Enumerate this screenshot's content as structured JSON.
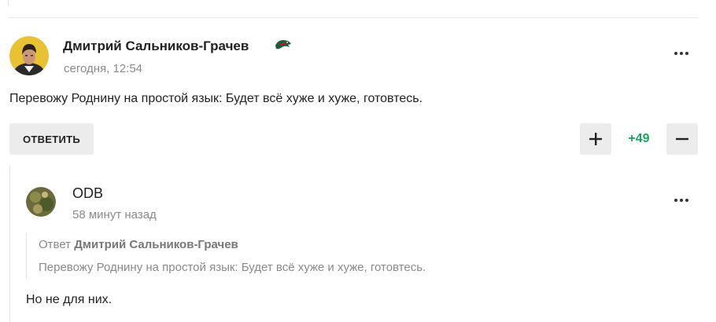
{
  "comments": [
    {
      "author": "Дмитрий Сальников-Грачев",
      "time": "сегодня, 12:54",
      "text": "Перевожу Роднину на простой язык: Будет всё хуже и хуже, готовтесь.",
      "reply_label": "ОТВЕТИТЬ",
      "score": "+49",
      "team_icon": "hockey-club-logo-icon"
    },
    {
      "author": "ODB",
      "time": "58 минут назад",
      "quote": {
        "prefix": "Ответ",
        "author": "Дмитрий Сальников-Грачев",
        "text": "Перевожу Роднину на простой язык: Будет всё хуже и хуже, готовтесь."
      },
      "text": "Но не для них."
    }
  ],
  "colors": {
    "score_positive": "#1aa361",
    "muted_text": "#8a8a8a",
    "button_bg": "#ececec"
  }
}
